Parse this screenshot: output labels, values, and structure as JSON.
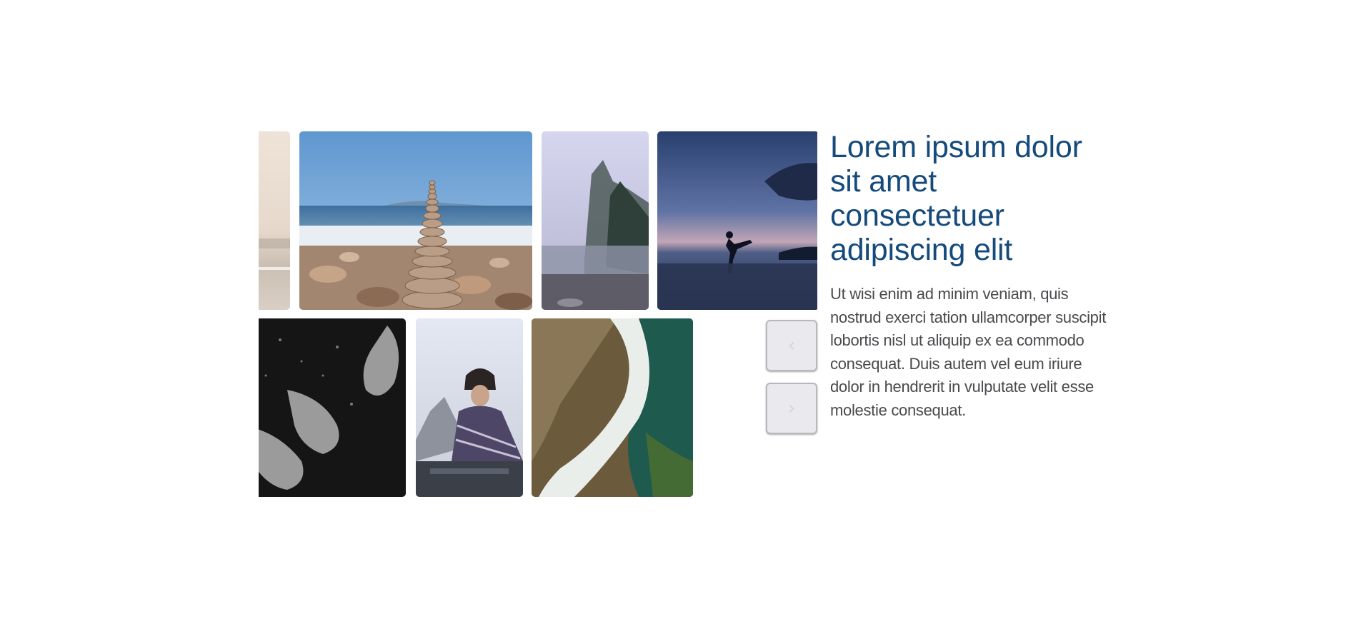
{
  "gallery": {
    "photos": [
      {
        "subject": "misty beach"
      },
      {
        "subject": "stacked stones on beach"
      },
      {
        "subject": "misty coastline trees"
      },
      {
        "subject": "person kicking on beach at dusk"
      },
      {
        "subject": "seals swimming underwater"
      },
      {
        "subject": "woman wrapped in blanket on car"
      },
      {
        "subject": "aerial ocean waves on shore"
      }
    ]
  },
  "controls": {
    "prev_icon": "‹",
    "next_icon": "›"
  },
  "content": {
    "title": "Lorem ipsum dolor sit amet consectetuer adipiscing elit",
    "body": "Ut wisi enim ad minim veniam, quis nostrud exerci tation ullamcorper suscipit lobortis nisl ut aliquip ex ea commodo consequat. Duis autem vel eum iriure dolor in hendrerit in vulputate velit esse molestie consequat."
  },
  "colors": {
    "title": "#154a7c",
    "body": "#4a4a4e",
    "button_bg": "#e9e9ee"
  }
}
